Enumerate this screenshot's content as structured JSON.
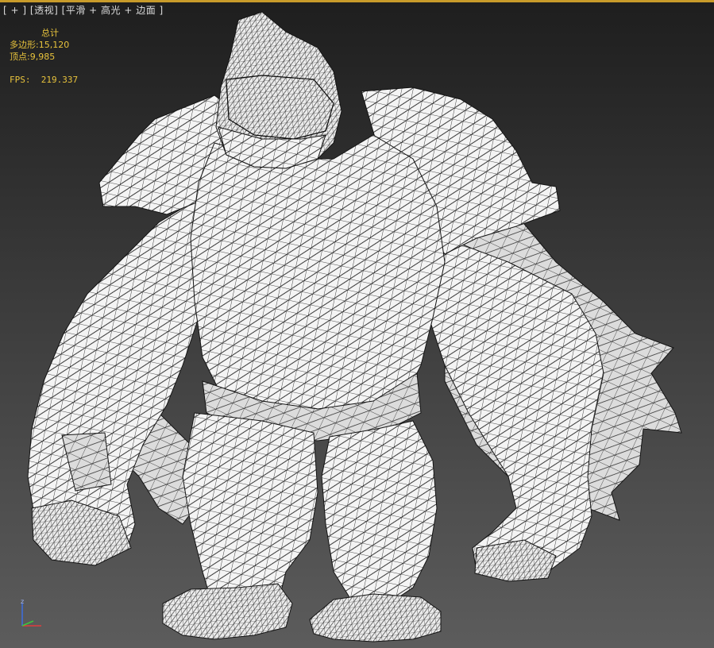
{
  "viewport": {
    "label_parts": [
      "[ + ]",
      "透视",
      "平滑 + 高光",
      "+ 边面",
      "]"
    ],
    "label_open": "[",
    "label_plus": "+",
    "label_view": "透视",
    "label_shading": "平滑 + 高光",
    "label_edges": "+ 边面",
    "label_close": "]"
  },
  "stats": {
    "total_label": "总计",
    "polys_label": "多边形:",
    "polys_value": "15,120",
    "verts_label": "顶点:",
    "verts_value": "9,985",
    "fps_label": "FPS:",
    "fps_value": "219.337"
  },
  "gizmo": {
    "z_label": "z",
    "x_color": "#e03c3c",
    "y_color": "#3cc83c",
    "z_color": "#3c6ee0"
  },
  "colors": {
    "accent_border": "#c89b2a",
    "stats_text": "#e8c33c",
    "mesh_fill": "#f4f4f4",
    "mesh_wire": "#141414"
  }
}
